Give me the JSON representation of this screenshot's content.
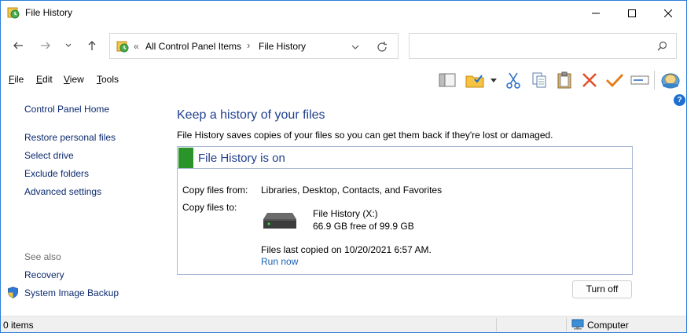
{
  "window": {
    "title": "File History",
    "icon": "file-history-icon"
  },
  "address": {
    "overflow": "«",
    "crumbs": [
      "All Control Panel Items",
      "File History"
    ],
    "separator": "›"
  },
  "search": {
    "placeholder": ""
  },
  "menu": {
    "file_key": "F",
    "file_rest": "ile",
    "edit_key": "E",
    "edit_rest": "dit",
    "view_key": "V",
    "view_rest": "iew",
    "tools_key": "T",
    "tools_rest": "ools"
  },
  "sidebar": {
    "home": "Control Panel Home",
    "links": [
      "Restore personal files",
      "Select drive",
      "Exclude folders",
      "Advanced settings"
    ],
    "see_also": "See also",
    "see_also_links": [
      "Recovery",
      "System Image Backup"
    ]
  },
  "main": {
    "heading": "Keep a history of your files",
    "description": "File History saves copies of your files so you can get them back if they're lost or damaged.",
    "status": "File History is on",
    "status_color": "#2a932a",
    "copy_from_label": "Copy files from:",
    "copy_from_value": "Libraries, Desktop, Contacts, and Favorites",
    "copy_to_label": "Copy files to:",
    "drive_name": "File History (X:)",
    "drive_free": "66.9 GB free of 99.9 GB",
    "last_copied": "Files last copied on 10/20/2021 6:57 AM.",
    "run_now": "Run now",
    "turn_off": "Turn off"
  },
  "statusbar": {
    "items": "0 items",
    "location": "Computer"
  }
}
